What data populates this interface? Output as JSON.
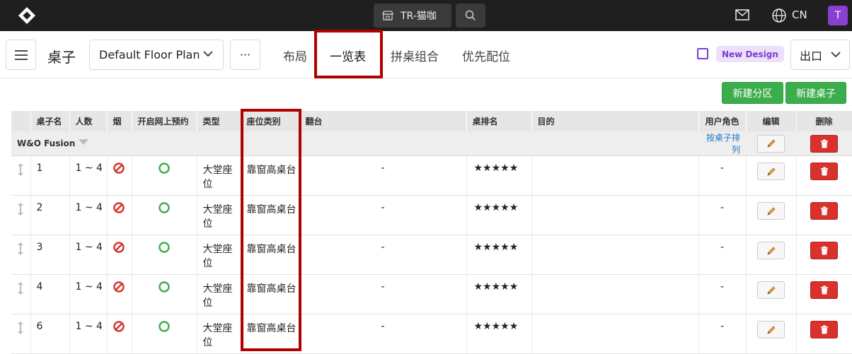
{
  "topbar": {
    "store_name": "TR-猫咖",
    "language": "CN",
    "avatar_letter": "T"
  },
  "subbar": {
    "title": "桌子",
    "floor_plan": "Default Floor Plan",
    "more": "···",
    "tabs": [
      "布局",
      "一览表",
      "拼桌组合",
      "优先配位"
    ],
    "active_tab": "一览表",
    "new_design": "New Design",
    "export": "出口"
  },
  "actions": {
    "new_section": "新建分区",
    "new_table": "新建桌子"
  },
  "table": {
    "headers": {
      "name": "桌子名",
      "people": "人数",
      "smoke": "烟",
      "online": "开启网上预约",
      "type": "类型",
      "seat": "座位类别",
      "turn": "翻台",
      "rank": "桌排名",
      "purpose": "目的",
      "role": "用户角色",
      "edit": "编辑",
      "delete": "删除"
    },
    "group": {
      "name": "W&O Fusion",
      "sort_link": "按桌子排列"
    },
    "rows": [
      {
        "name": "1",
        "people": "1 ~ 4",
        "type": "大堂座位",
        "seat": "靠窗高桌台",
        "turn": "-",
        "rank": "★★★★★",
        "purpose": "",
        "role": "-"
      },
      {
        "name": "2",
        "people": "1 ~ 4",
        "type": "大堂座位",
        "seat": "靠窗高桌台",
        "turn": "-",
        "rank": "★★★★★",
        "purpose": "",
        "role": "-"
      },
      {
        "name": "3",
        "people": "1 ~ 4",
        "type": "大堂座位",
        "seat": "靠窗高桌台",
        "turn": "-",
        "rank": "★★★★★",
        "purpose": "",
        "role": "-"
      },
      {
        "name": "4",
        "people": "1 ~ 4",
        "type": "大堂座位",
        "seat": "靠窗高桌台",
        "turn": "-",
        "rank": "★★★★★",
        "purpose": "",
        "role": "-"
      },
      {
        "name": "6",
        "people": "1 ~ 4",
        "type": "大堂座位",
        "seat": "靠窗高桌台",
        "turn": "-",
        "rank": "★★★★★",
        "purpose": "",
        "role": "-"
      }
    ]
  },
  "colors": {
    "topbar": "#1f1f1f",
    "accent_purple": "#7a3fd1",
    "green": "#3cad4c",
    "delete_red": "#d9312b",
    "highlight": "#b00000"
  }
}
